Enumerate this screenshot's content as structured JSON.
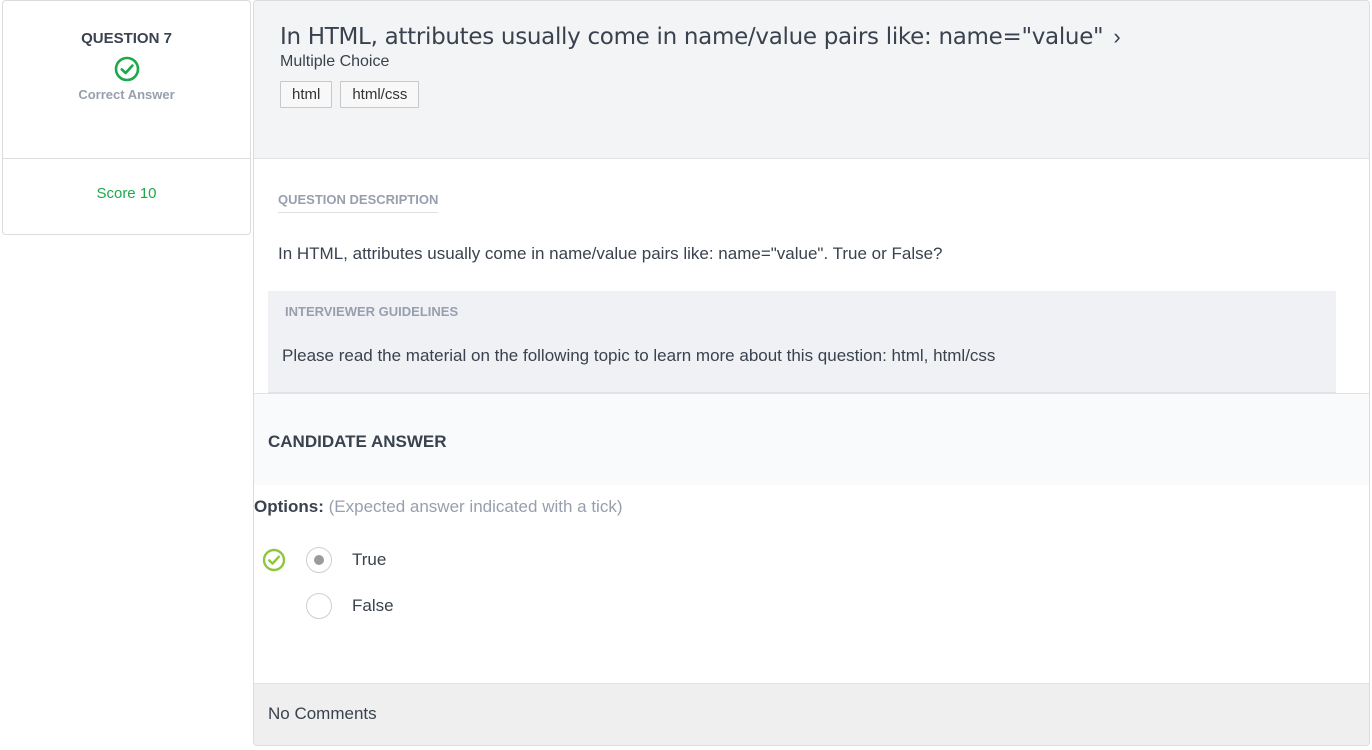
{
  "question": {
    "number_label": "QUESTION 7",
    "status": "Correct Answer",
    "score_label": "Score 10"
  },
  "header": {
    "title": "In HTML, attributes usually come in name/value pairs like: name=\"value\"",
    "type": "Multiple Choice",
    "tags": [
      "html",
      "html/css"
    ]
  },
  "description": {
    "label": "QUESTION DESCRIPTION",
    "text": "In HTML, attributes usually come in name/value pairs like: name=\"value\". True or False?"
  },
  "guidelines": {
    "label": "INTERVIEWER GUIDELINES",
    "text": "Please read the material on the following topic to learn more about this question: html, html/css"
  },
  "answer": {
    "label": "CANDIDATE ANSWER",
    "options_label": "Options:",
    "options_hint": "(Expected answer indicated with a tick)",
    "options": [
      {
        "label": "True",
        "expected": true,
        "selected": true
      },
      {
        "label": "False",
        "expected": false,
        "selected": false
      }
    ]
  },
  "comments": "No Comments",
  "colors": {
    "correct": "#1ba94c",
    "tick": "#8dc63f"
  }
}
